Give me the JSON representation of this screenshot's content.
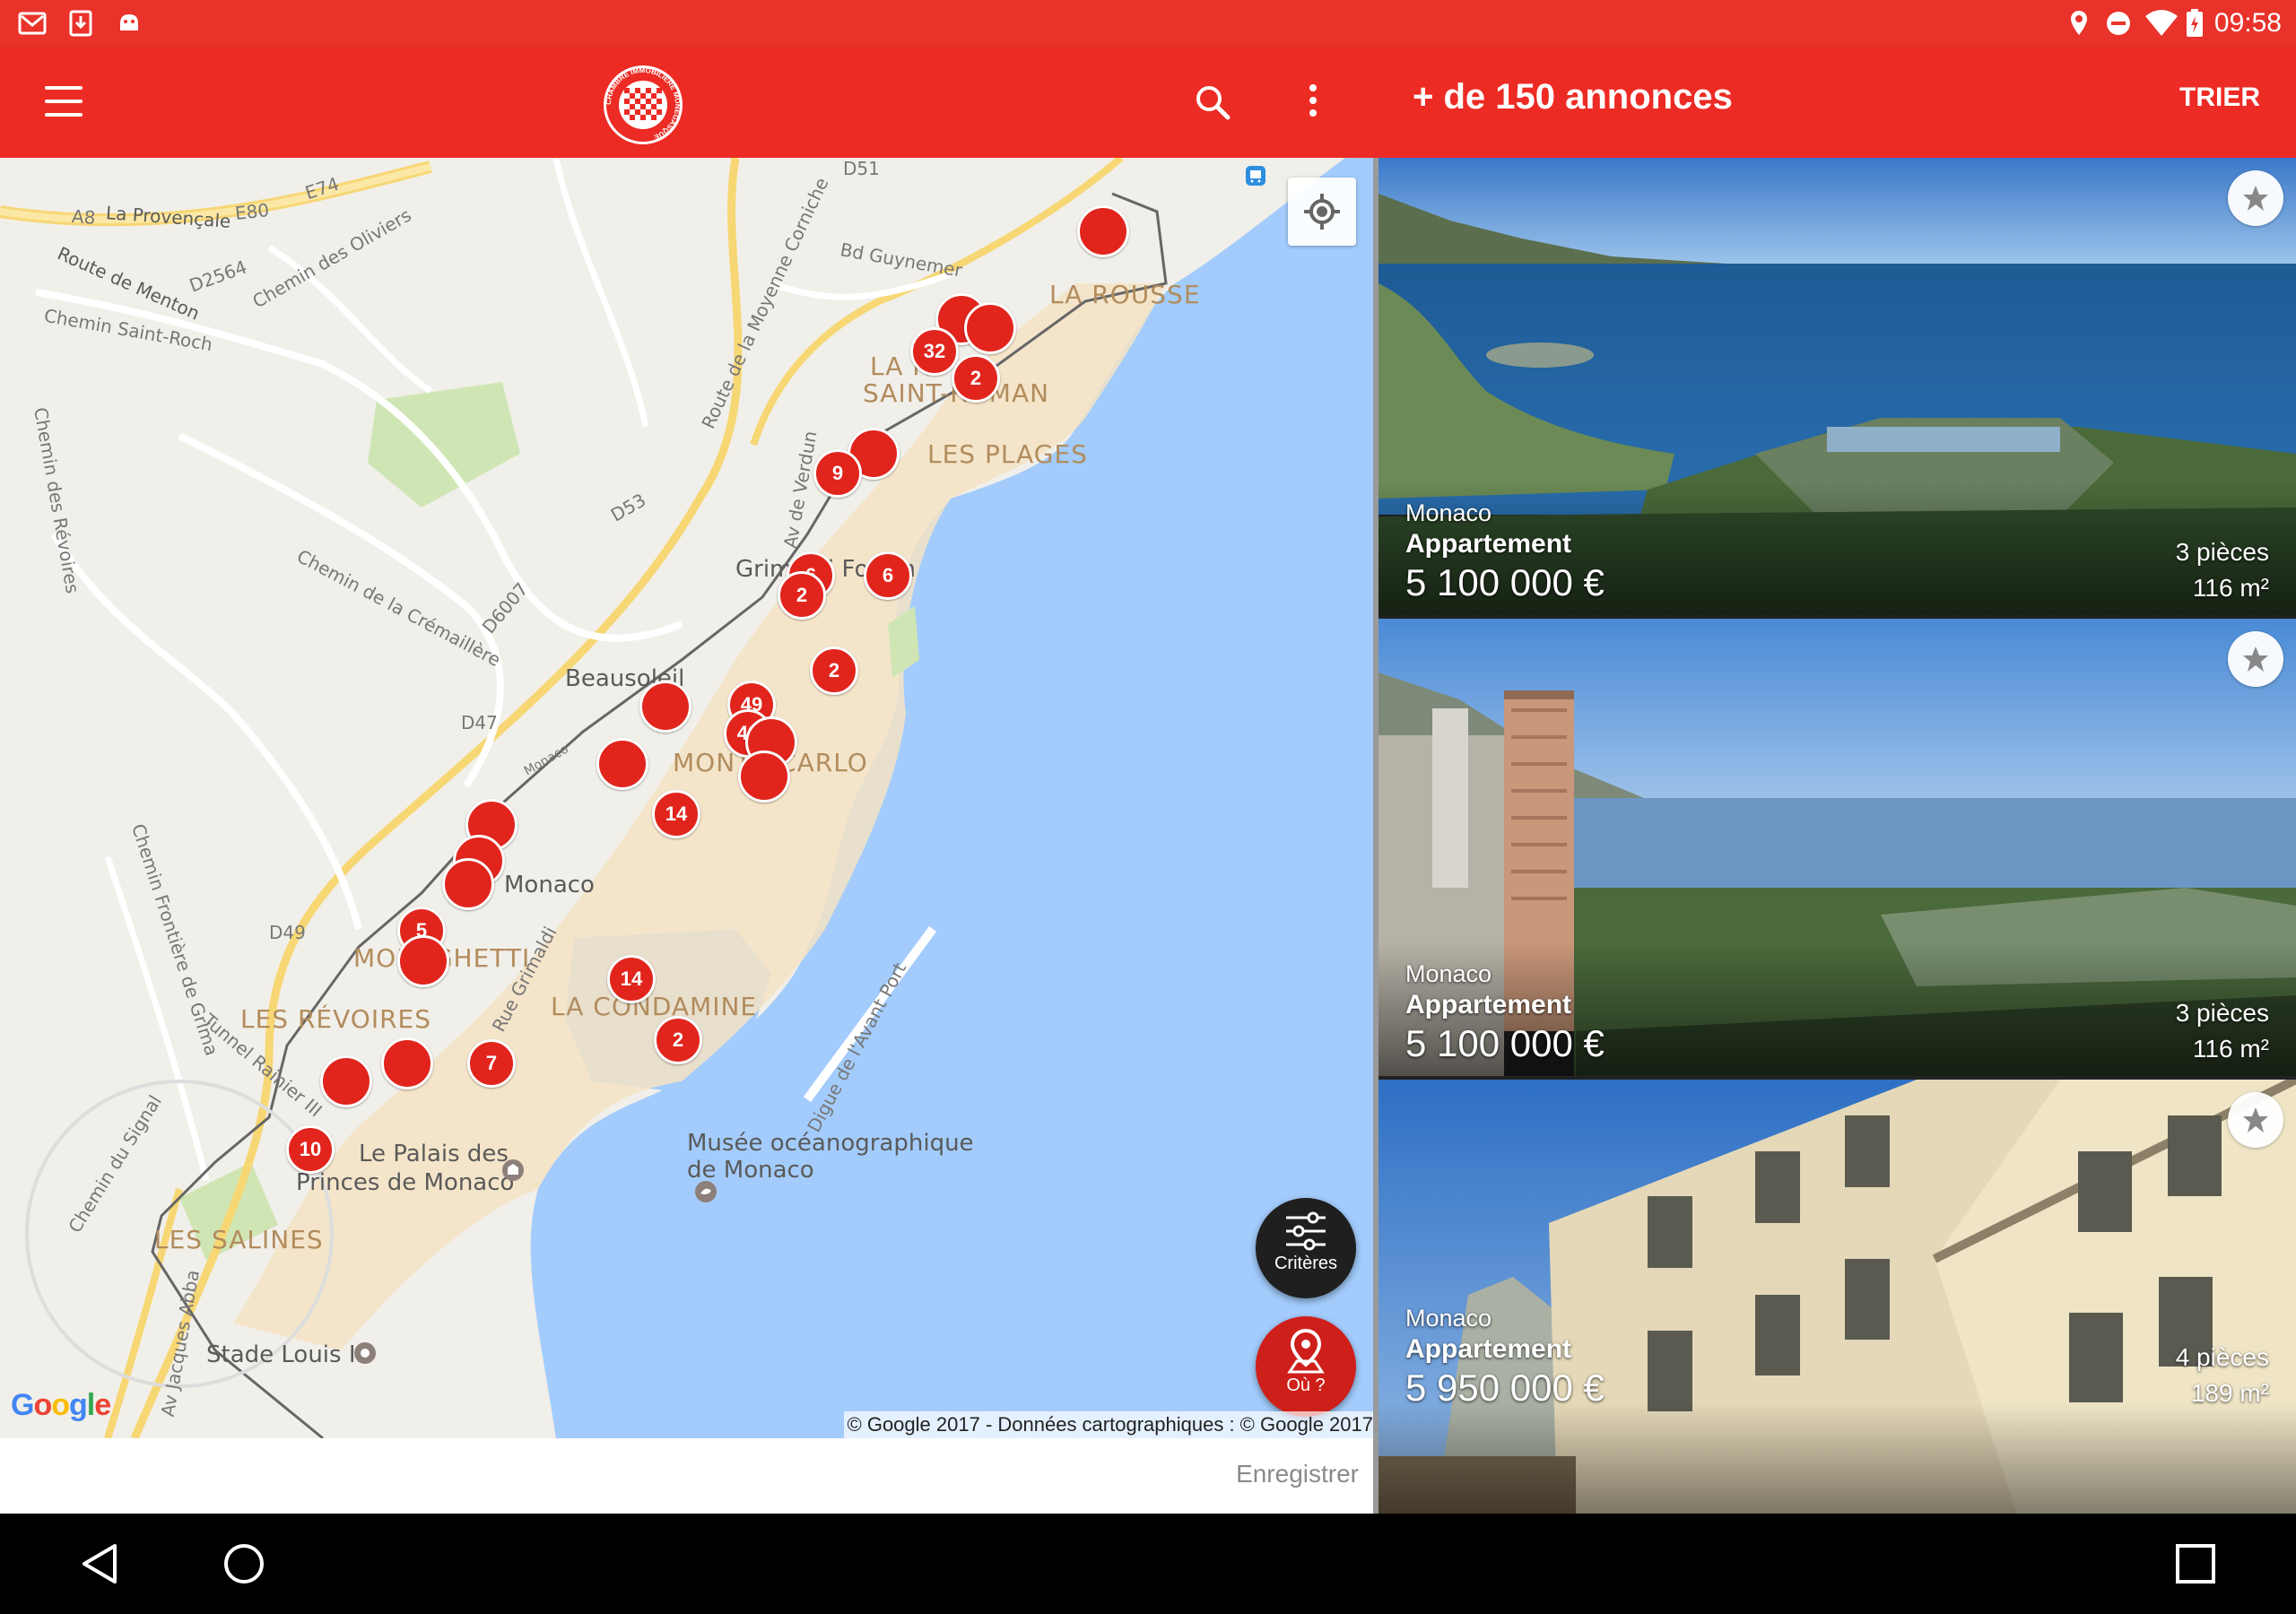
{
  "status_bar": {
    "time": "09:58",
    "left_icons": [
      "gmail-icon",
      "download-icon",
      "android-icon"
    ],
    "right_icons": [
      "location-icon",
      "do-not-disturb-icon",
      "wifi-icon",
      "battery-icon"
    ]
  },
  "app_bar": {
    "menu_icon": "hamburger-menu-icon",
    "logo": "chambre-immobiliere-monegasque-logo",
    "logo_text": "CHAMBRE IMMOBILIERE MONEGASQUE",
    "search_icon": "search-icon",
    "more_icon": "more-vert-icon"
  },
  "results": {
    "title": "+ de 150 annonces",
    "sort_label": "TRIER"
  },
  "map": {
    "labels": {
      "provencale": "La Provençale",
      "e80": "E80",
      "e74": "E74",
      "a8": "A8",
      "route_menton": "Route de Menton",
      "d2564": "D2564",
      "chemin_oliviers": "Chemin des Oliviers",
      "chemin_saint_roch": "Chemin Saint-Roch",
      "route_moyenne_corniche": "Route de la Moyenne Corniche",
      "bd_guynemer": "Bd Guynemer",
      "d51": "D51",
      "la_rousse": "LA ROUSSE",
      "saint_roman_1": "LA R",
      "saint_roman_2": "SAINT-ROMAN",
      "les_plages": "LES PLAGES",
      "chemin_revoires": "Chemin des Révoires",
      "d53": "D53",
      "av_verdun": "Av de Verdun",
      "chemin_cremailliere": "Chemin de la Crémaillère",
      "d6007": "D6007",
      "grimaldi_forum": "Grimaldi Forum",
      "beausoleil": "Beausoleil",
      "d47": "D47",
      "monaco_road": "Monaco",
      "monte_carlo": "MONTE-CARLO",
      "monaco": "Monaco",
      "chemin_frontiere": "Chemin Frontière de Grima",
      "d49": "D49",
      "moneghetti": "MONEGHETTI",
      "rue_grimaldi": "Rue Grimaldi",
      "la_condamine": "LA CONDAMINE",
      "digue": "Digue de l'Avant Port",
      "les_revoires": "LES RÉVOIRES",
      "tunnel_rainier": "Tunnel Rainier III",
      "chemin_signal": "Chemin du Signal",
      "palais_1": "Le Palais des",
      "palais_2": "Princes de Monaco",
      "musee_1": "Musée océanographique",
      "musee_2": "de Monaco",
      "les_salines": "LES SALINES",
      "av_jacques_abba": "Av Jacques Abba",
      "stade": "Stade Louis II"
    },
    "markers": [
      {
        "id": "m1",
        "count": ""
      },
      {
        "id": "m2",
        "count": ""
      },
      {
        "id": "m3",
        "count": ""
      },
      {
        "id": "m4",
        "count": "32"
      },
      {
        "id": "m5",
        "count": "2"
      },
      {
        "id": "m6",
        "count": ""
      },
      {
        "id": "m7",
        "count": "9"
      },
      {
        "id": "m8",
        "count": "6"
      },
      {
        "id": "m9",
        "count": "6"
      },
      {
        "id": "m10",
        "count": "2"
      },
      {
        "id": "m11",
        "count": "2"
      },
      {
        "id": "m12",
        "count": ""
      },
      {
        "id": "m13",
        "count": "49"
      },
      {
        "id": "m14",
        "count": "42"
      },
      {
        "id": "m15",
        "count": ""
      },
      {
        "id": "m16",
        "count": ""
      },
      {
        "id": "m17",
        "count": ""
      },
      {
        "id": "m18",
        "count": "14"
      },
      {
        "id": "m19",
        "count": ""
      },
      {
        "id": "m20",
        "count": ""
      },
      {
        "id": "m21",
        "count": ""
      },
      {
        "id": "m22",
        "count": "5"
      },
      {
        "id": "m23",
        "count": ""
      },
      {
        "id": "m24",
        "count": "14"
      },
      {
        "id": "m25",
        "count": "2"
      },
      {
        "id": "m26",
        "count": "7"
      },
      {
        "id": "m27",
        "count": ""
      },
      {
        "id": "m28",
        "count": ""
      },
      {
        "id": "m29",
        "count": "10"
      }
    ],
    "locate_icon": "my-location-icon",
    "google_logo": "Google",
    "copyright": "© Google 2017 - Données cartographiques : © Google 2017",
    "criteria_button": {
      "label": "Critères",
      "icon": "tune-sliders-icon"
    },
    "where_button": {
      "label": "Où ?",
      "icon": "place-pin-icon"
    }
  },
  "save_bar": {
    "save_label": "Enregistrer"
  },
  "listings": [
    {
      "city": "Monaco",
      "type": "Appartement",
      "price": "5 100 000 €",
      "rooms": "3 pièces",
      "area": "116 m²",
      "favorite_icon": "star-icon"
    },
    {
      "city": "Monaco",
      "type": "Appartement",
      "price": "5 100 000 €",
      "rooms": "3 pièces",
      "area": "116 m²",
      "favorite_icon": "star-icon"
    },
    {
      "city": "Monaco",
      "type": "Appartement",
      "price": "5 950 000 €",
      "rooms": "4 pièces",
      "area": "189 m²",
      "favorite_icon": "star-icon"
    }
  ],
  "nav_bar": {
    "back_icon": "back-triangle-icon",
    "home_icon": "home-circle-icon",
    "recents_icon": "recents-square-icon"
  },
  "colors": {
    "brand_red": "#ec2b24",
    "marker_red": "#e1251d",
    "sea": "#a3ccfc"
  }
}
